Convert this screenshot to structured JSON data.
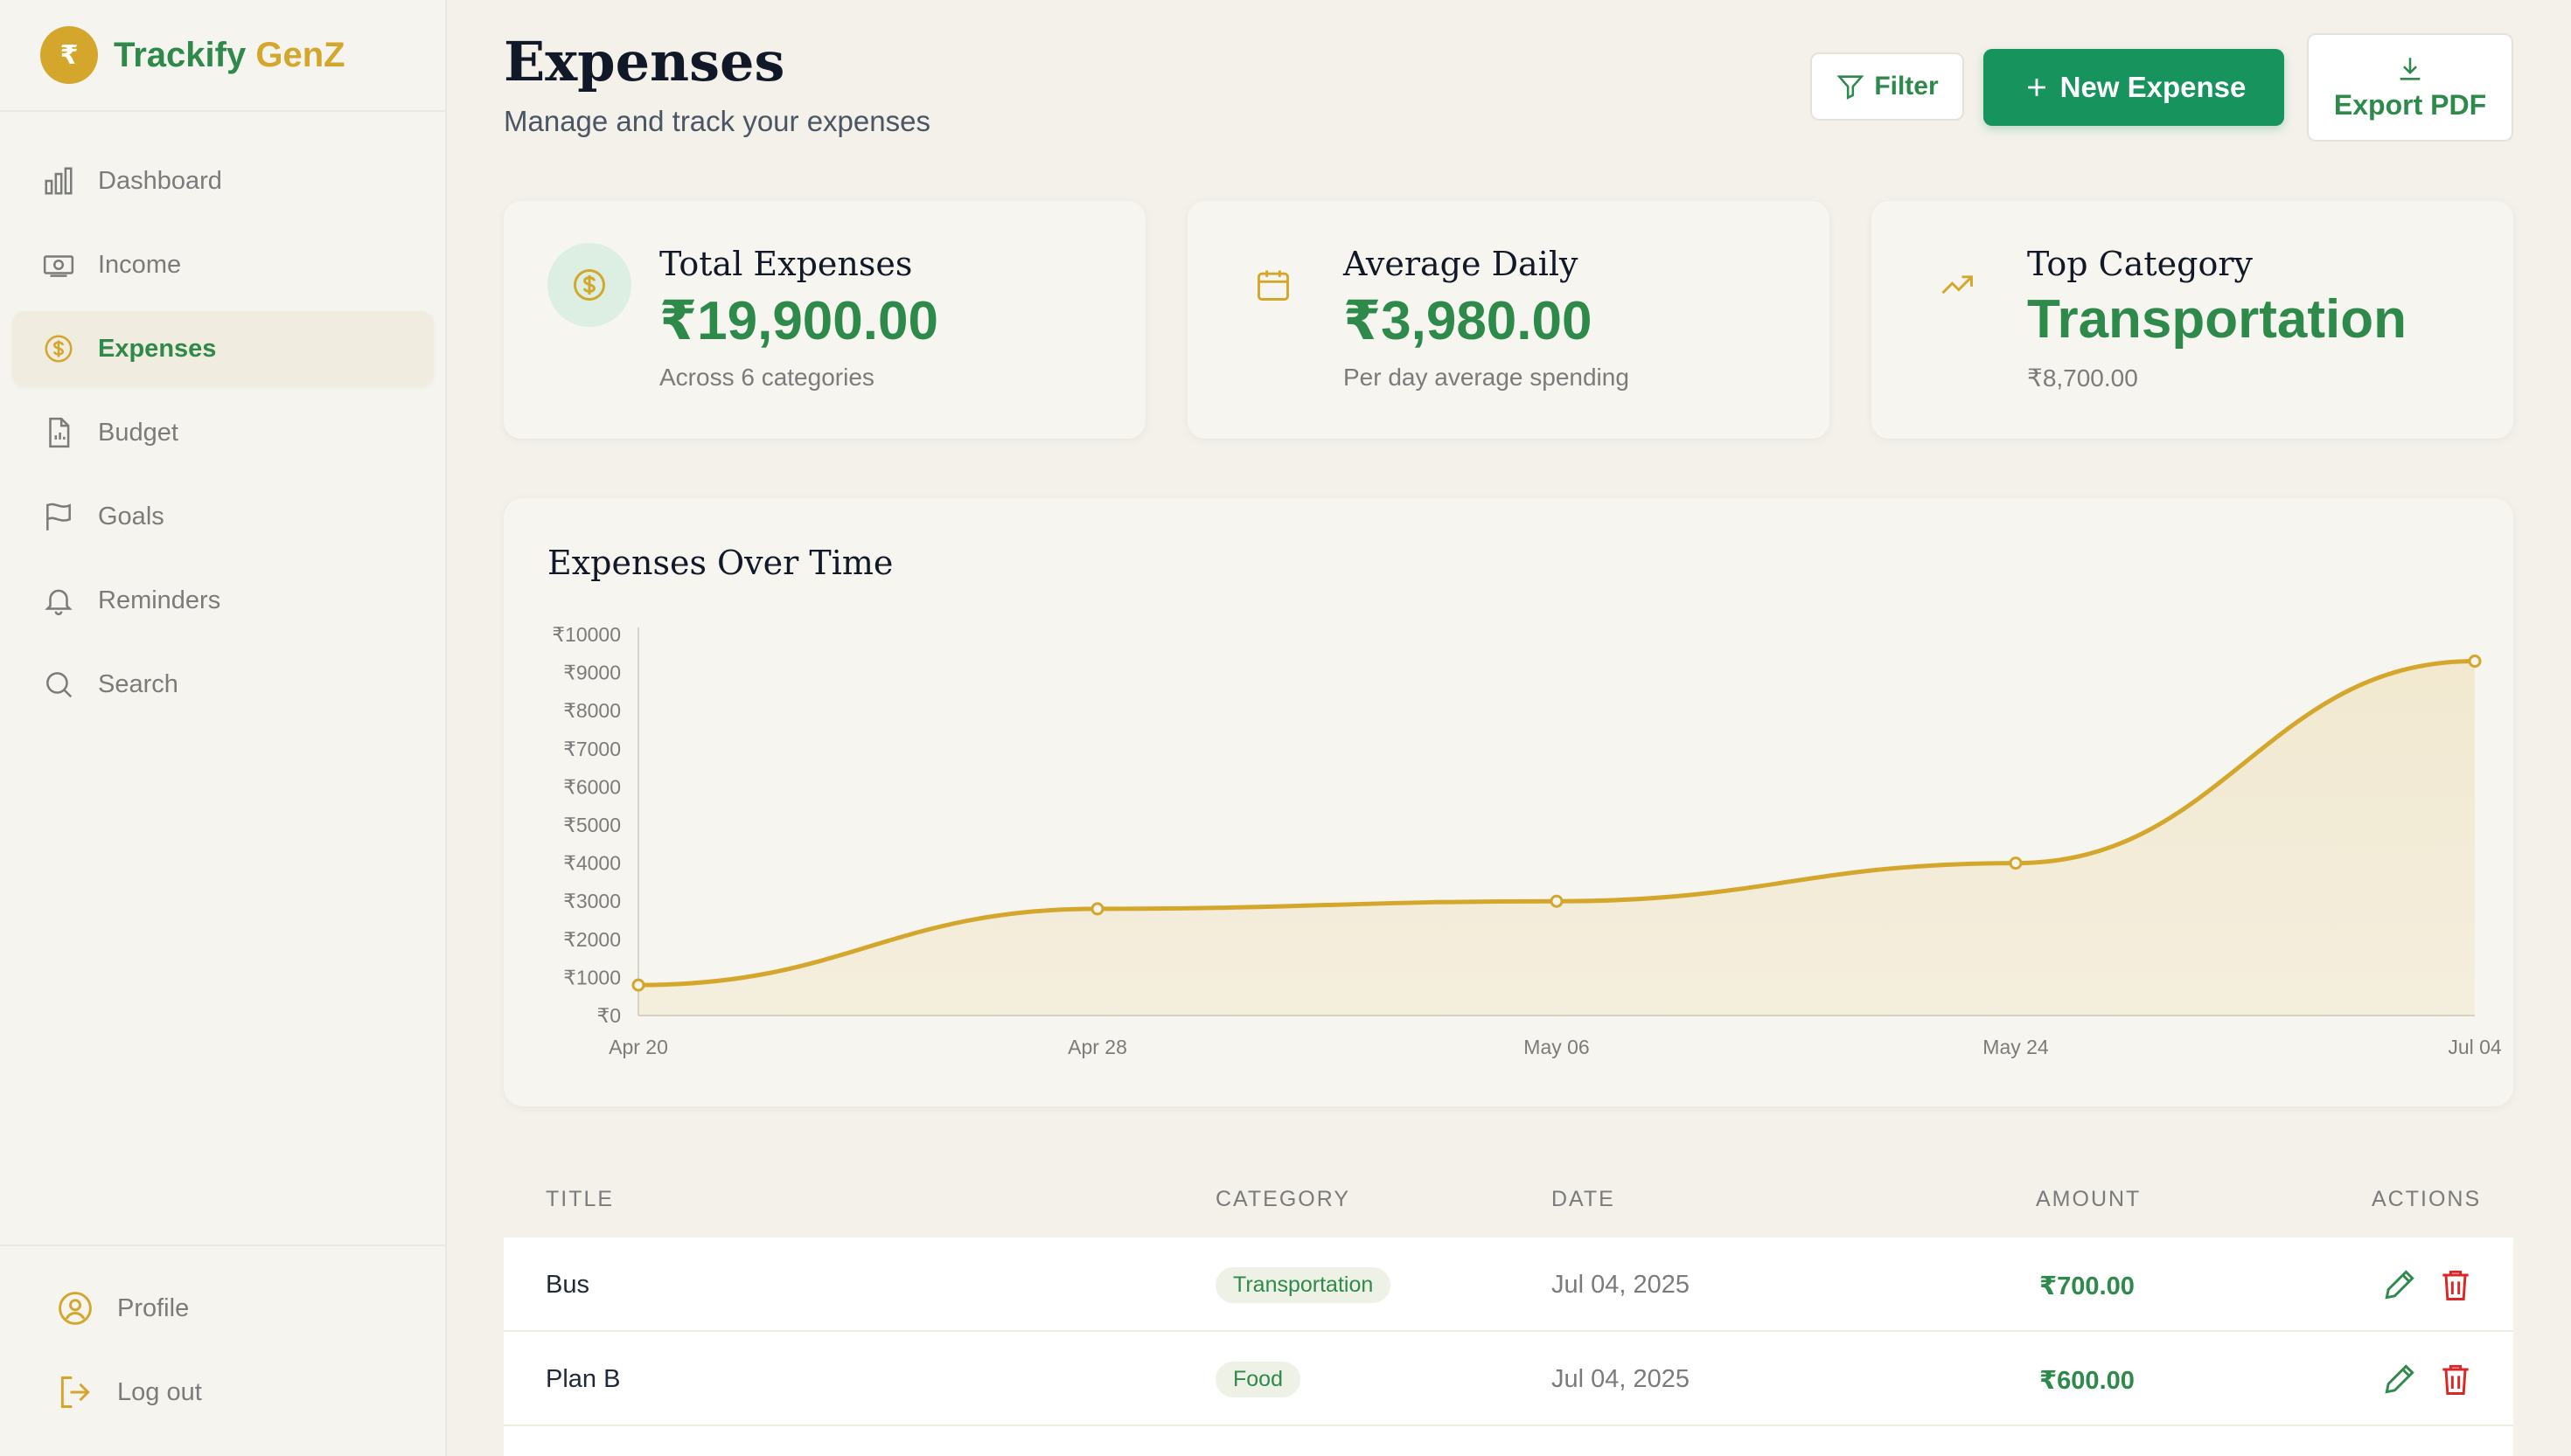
{
  "brand": {
    "logo_glyph": "₹",
    "name_a": "Trackify",
    "name_b": "GenZ"
  },
  "nav": [
    {
      "label": "Dashboard",
      "icon": "bar-chart-icon"
    },
    {
      "label": "Income",
      "icon": "banknote-icon"
    },
    {
      "label": "Expenses",
      "icon": "dollar-circle-icon",
      "active": true
    },
    {
      "label": "Budget",
      "icon": "document-chart-icon"
    },
    {
      "label": "Goals",
      "icon": "flag-icon"
    },
    {
      "label": "Reminders",
      "icon": "bell-icon"
    },
    {
      "label": "Search",
      "icon": "search-icon"
    }
  ],
  "bottom_nav": [
    {
      "label": "Profile",
      "icon": "user-circle-icon"
    },
    {
      "label": "Log out",
      "icon": "logout-icon"
    }
  ],
  "header": {
    "title": "Expenses",
    "subtitle": "Manage and track your expenses",
    "filter_label": "Filter",
    "new_label": "New Expense",
    "export_label": "Export PDF"
  },
  "cards": [
    {
      "title": "Total Expenses",
      "value": "₹19,900.00",
      "sub": "Across 6 categories"
    },
    {
      "title": "Average Daily",
      "value": "₹3,980.00",
      "sub": "Per day average spending"
    },
    {
      "title": "Top Category",
      "value": "Transportation",
      "sub": "₹8,700.00"
    }
  ],
  "colors": {
    "accent": "#2e8a4a",
    "gold": "#d4a72c",
    "primary_button": "#17935d",
    "danger": "#dc2626"
  },
  "chart_data": {
    "type": "area",
    "title": "Expenses Over Time",
    "x": [
      "Apr 20",
      "Apr 28",
      "May 06",
      "May 24",
      "Jul 04"
    ],
    "values": [
      800,
      2800,
      3000,
      4000,
      9300
    ],
    "ylim": [
      0,
      10000
    ],
    "yticks": [
      "₹0",
      "₹1000",
      "₹2000",
      "₹3000",
      "₹4000",
      "₹5000",
      "₹6000",
      "₹7000",
      "₹8000",
      "₹9000",
      "₹10000"
    ],
    "grid": false
  },
  "table": {
    "headers": {
      "title": "TITLE",
      "category": "CATEGORY",
      "date": "DATE",
      "amount": "AMOUNT",
      "actions": "ACTIONS"
    },
    "rows": [
      {
        "title": "Bus",
        "category": "Transportation",
        "date": "Jul 04, 2025",
        "amount": "₹700.00"
      },
      {
        "title": "Plan B",
        "category": "Food",
        "date": "Jul 04, 2025",
        "amount": "₹600.00"
      }
    ]
  }
}
